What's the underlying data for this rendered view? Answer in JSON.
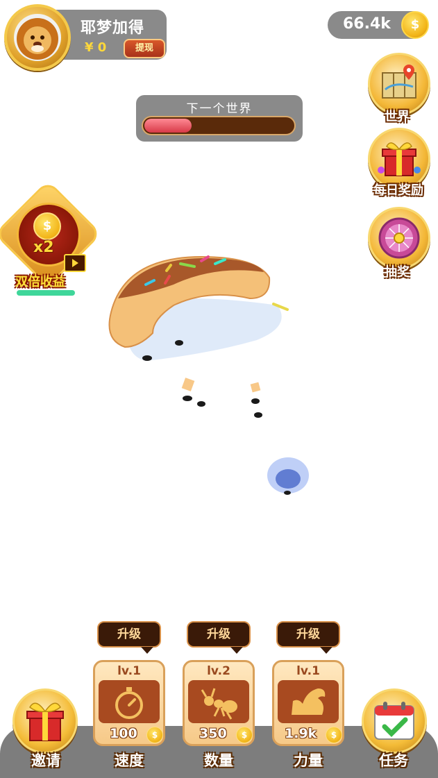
{
  "profile": {
    "username": "耶梦加得",
    "balance": "¥ 0",
    "withdraw_label": "提现"
  },
  "coins": {
    "amount": "66.4k",
    "icon": "coin-icon",
    "coin_symbol": "$"
  },
  "progress": {
    "title": "下一个世界",
    "value": 0.32
  },
  "side_menu": {
    "world_label": "世界",
    "daily_reward_label": "每日奖励",
    "lottery_label": "抽奖"
  },
  "double_income": {
    "multiplier": "x2",
    "label": "双倍收益",
    "coin_symbol": "$"
  },
  "upgrades": [
    {
      "upgrade_label": "升级",
      "level": "lv.1",
      "price": "100",
      "label": "速度",
      "icon": "stopwatch-icon"
    },
    {
      "upgrade_label": "升级",
      "level": "lv.2",
      "price": "350",
      "label": "数量",
      "icon": "ant-icon"
    },
    {
      "upgrade_label": "升级",
      "level": "lv.1",
      "price": "1.9k",
      "label": "力量",
      "icon": "muscle-icon"
    }
  ],
  "bottom_buttons": {
    "invite_label": "邀请",
    "tasks_label": "任务"
  },
  "colors": {
    "panel_gray": "#8a8a8a",
    "gold": "#f2b418",
    "progress_red": "#d83a48",
    "card_brown": "#a84a20",
    "green_bar": "#3fd69a"
  }
}
